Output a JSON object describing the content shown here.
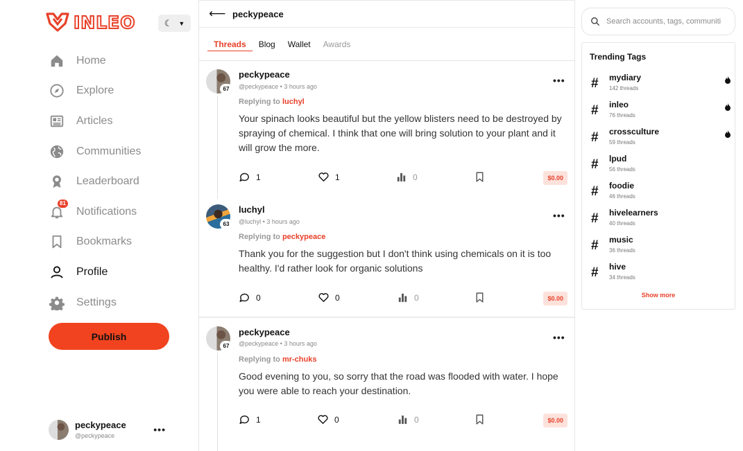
{
  "brand": {
    "name": "INLEO",
    "accent": "#e8412a"
  },
  "nav": {
    "items": [
      {
        "label": "Home",
        "icon": "home-icon"
      },
      {
        "label": "Explore",
        "icon": "compass-icon"
      },
      {
        "label": "Articles",
        "icon": "newspaper-icon"
      },
      {
        "label": "Communities",
        "icon": "globe-icon"
      },
      {
        "label": "Leaderboard",
        "icon": "award-icon"
      },
      {
        "label": "Notifications",
        "icon": "bell-icon",
        "badge": "81"
      },
      {
        "label": "Bookmarks",
        "icon": "bookmark-icon"
      },
      {
        "label": "Profile",
        "icon": "user-icon",
        "active": true
      },
      {
        "label": "Settings",
        "icon": "gear-icon"
      }
    ],
    "publish_label": "Publish"
  },
  "current_user": {
    "name": "peckypeace",
    "handle": "@peckypeace"
  },
  "header": {
    "title": "peckypeace"
  },
  "tabs": [
    {
      "label": "Threads",
      "active": true
    },
    {
      "label": "Blog"
    },
    {
      "label": "Wallet"
    },
    {
      "label": "Awards",
      "muted": true
    }
  ],
  "threads": [
    {
      "user": "peckypeace",
      "handle": "@peckypeace",
      "time": "3 hours ago",
      "level": "67",
      "reply_prefix": "Replying to",
      "reply_to": "luchyl",
      "body": "Your spinach looks beautiful but the yellow blisters need to be destroyed by spraying of chemical. I think that one will bring solution to your plant and it will grow the more.",
      "comments": "1",
      "likes": "1",
      "views": "0",
      "tip": "$0.00"
    },
    {
      "user": "luchyl",
      "handle": "@luchyl",
      "time": "3 hours ago",
      "level": "63",
      "reply_prefix": "Replying to",
      "reply_to": "peckypeace",
      "body": "Thank you for the suggestion but I don't think using chemicals on it is too healthy. I'd rather look for organic solutions",
      "comments": "0",
      "likes": "0",
      "views": "0",
      "tip": "$0.00"
    },
    {
      "user": "peckypeace",
      "handle": "@peckypeace",
      "time": "3 hours ago",
      "level": "67",
      "reply_prefix": "Replying to",
      "reply_to": "mr-chuks",
      "body": "Good evening to you, so sorry that the road was flooded with water. I hope you were able to reach your destination.",
      "comments": "1",
      "likes": "0",
      "views": "0",
      "tip": "$0.00"
    }
  ],
  "search": {
    "placeholder": "Search accounts, tags, communities"
  },
  "trending": {
    "title": "Trending Tags",
    "tags": [
      {
        "name": "mydiary",
        "count": "142 threads",
        "hot": true
      },
      {
        "name": "inleo",
        "count": "76 threads",
        "hot": true
      },
      {
        "name": "crossculture",
        "count": "59 threads",
        "hot": true
      },
      {
        "name": "lpud",
        "count": "56 threads"
      },
      {
        "name": "foodie",
        "count": "46 threads"
      },
      {
        "name": "hivelearners",
        "count": "40 threads"
      },
      {
        "name": "music",
        "count": "36 threads"
      },
      {
        "name": "hive",
        "count": "34 threads"
      }
    ],
    "show_more": "Show more"
  }
}
